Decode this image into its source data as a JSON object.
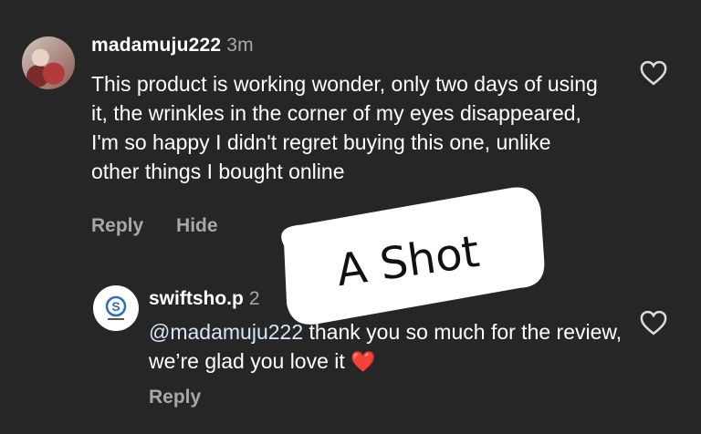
{
  "comment": {
    "username": "madamuju222",
    "time": "3m",
    "text": "This product is working wonder, only two days of using it, the wrinkles in the corner of my eyes disappeared, I'm so happy I didn't regret buying this one, unlike other things I bought online",
    "reply_label": "Reply",
    "hide_label": "Hide"
  },
  "reply": {
    "username": "swiftsho.p",
    "time": "2",
    "mention": "@madamuju222",
    "text": " thank you so much for the review, we’re glad you love it ",
    "emoji": "❤️",
    "reply_label": "Reply",
    "avatar_text": "S"
  },
  "watermark": {
    "text": "A Shot"
  },
  "icons": {
    "like": "heart-outline-icon"
  },
  "colors": {
    "background": "#262626",
    "secondary": "#a8a8a8"
  }
}
